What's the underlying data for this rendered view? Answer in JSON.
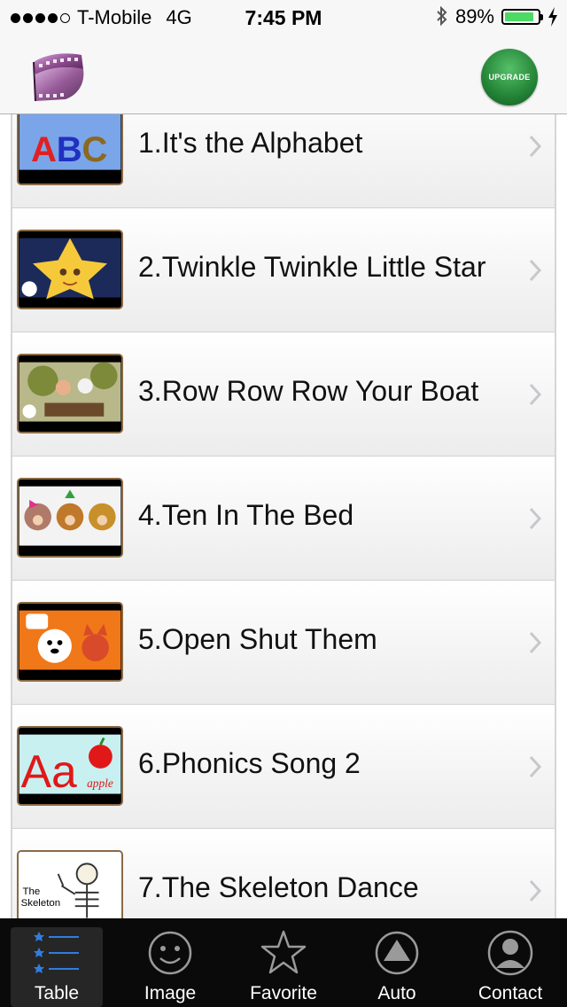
{
  "status_bar": {
    "carrier": "T-Mobile",
    "network": "4G",
    "time": "7:45 PM",
    "battery_percent": "89%",
    "battery_level": 0.89,
    "signal_bars": 4
  },
  "nav": {
    "logo_icon": "film-reel-icon",
    "upgrade_label": "UPGRADE"
  },
  "list": {
    "items": [
      {
        "title": "1.It's the Alphabet",
        "thumb": "abc"
      },
      {
        "title": "2.Twinkle Twinkle Little Star",
        "thumb": "star"
      },
      {
        "title": "3.Row Row Row Your Boat",
        "thumb": "boat"
      },
      {
        "title": "4.Ten In The Bed",
        "thumb": "bears"
      },
      {
        "title": "5.Open Shut Them",
        "thumb": "dog"
      },
      {
        "title": "6.Phonics Song 2",
        "thumb": "phonics"
      },
      {
        "title": "7.The Skeleton Dance",
        "thumb": "skeleton"
      }
    ],
    "thumb_text": {
      "abc": "ABC",
      "phonics_letters": "Aa",
      "phonics_word": "apple",
      "skeleton_word_1": "The",
      "skeleton_word_2": "Skeleton"
    }
  },
  "tabs": [
    {
      "label": "Table",
      "icon": "list-icon",
      "active": true
    },
    {
      "label": "Image",
      "icon": "smiley-icon",
      "active": false
    },
    {
      "label": "Favorite",
      "icon": "star-icon",
      "active": false
    },
    {
      "label": "Auto",
      "icon": "auto-play-icon",
      "active": false
    },
    {
      "label": "Contact",
      "icon": "contact-icon",
      "active": false
    }
  ],
  "colors": {
    "accent_green": "#27883a",
    "battery_green": "#4cd964",
    "tab_active_blue": "#2f7de1"
  }
}
